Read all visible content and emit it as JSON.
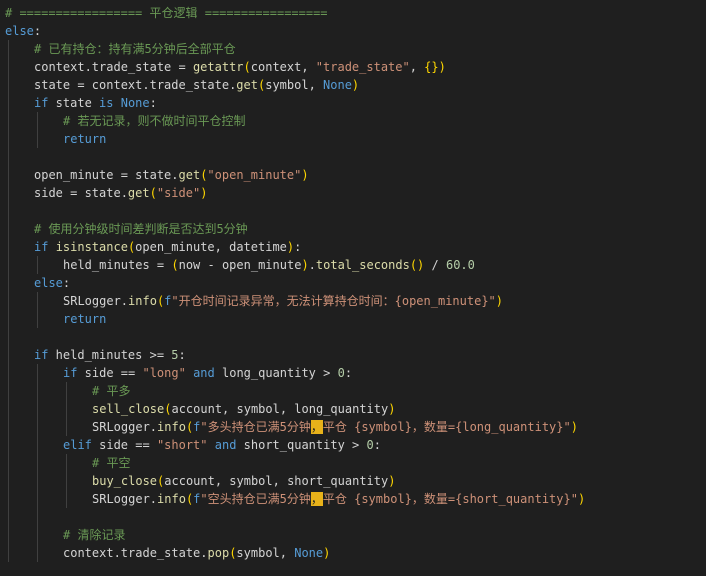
{
  "editor": {
    "language": "python",
    "colors": {
      "background": "#1f1f1f",
      "comment": "#6a9955",
      "keyword": "#569cd6",
      "function": "#dcdcaa",
      "string": "#ce9178",
      "number": "#b5cea8",
      "text": "#d4d4d4",
      "bracket": "#ffd700",
      "highlight": "#e8b21a"
    },
    "lines": [
      {
        "indent": 0,
        "tokens": [
          {
            "t": "# ================= 平仓逻辑 =================",
            "c": "comment"
          }
        ]
      },
      {
        "indent": 0,
        "tokens": [
          {
            "t": "else",
            "c": "keyword"
          },
          {
            "t": ":",
            "c": "plain"
          }
        ]
      },
      {
        "indent": 1,
        "tokens": [
          {
            "t": "# 已有持仓：持有满5分钟后全部平仓",
            "c": "comment"
          }
        ]
      },
      {
        "indent": 1,
        "tokens": [
          {
            "t": "context.trade_state = ",
            "c": "plain"
          },
          {
            "t": "getattr",
            "c": "func"
          },
          {
            "t": "(",
            "c": "paren"
          },
          {
            "t": "context, ",
            "c": "plain"
          },
          {
            "t": "\"trade_state\"",
            "c": "string"
          },
          {
            "t": ", ",
            "c": "plain"
          },
          {
            "t": "{}",
            "c": "paren"
          },
          {
            "t": ")",
            "c": "paren"
          }
        ]
      },
      {
        "indent": 1,
        "tokens": [
          {
            "t": "state = context.trade_state.",
            "c": "plain"
          },
          {
            "t": "get",
            "c": "func"
          },
          {
            "t": "(",
            "c": "paren"
          },
          {
            "t": "symbol, ",
            "c": "plain"
          },
          {
            "t": "None",
            "c": "keyword"
          },
          {
            "t": ")",
            "c": "paren"
          }
        ]
      },
      {
        "indent": 1,
        "tokens": [
          {
            "t": "if",
            "c": "keyword"
          },
          {
            "t": " state ",
            "c": "plain"
          },
          {
            "t": "is",
            "c": "keyword"
          },
          {
            "t": " ",
            "c": "plain"
          },
          {
            "t": "None",
            "c": "keyword"
          },
          {
            "t": ":",
            "c": "plain"
          }
        ]
      },
      {
        "indent": 2,
        "tokens": [
          {
            "t": "# 若无记录，则不做时间平仓控制",
            "c": "comment"
          }
        ]
      },
      {
        "indent": 2,
        "tokens": [
          {
            "t": "return",
            "c": "keyword"
          }
        ]
      },
      {
        "indent": 1,
        "tokens": []
      },
      {
        "indent": 1,
        "tokens": [
          {
            "t": "open_minute = state.",
            "c": "plain"
          },
          {
            "t": "get",
            "c": "func"
          },
          {
            "t": "(",
            "c": "paren"
          },
          {
            "t": "\"open_minute\"",
            "c": "string"
          },
          {
            "t": ")",
            "c": "paren"
          }
        ]
      },
      {
        "indent": 1,
        "tokens": [
          {
            "t": "side = state.",
            "c": "plain"
          },
          {
            "t": "get",
            "c": "func"
          },
          {
            "t": "(",
            "c": "paren"
          },
          {
            "t": "\"side\"",
            "c": "string"
          },
          {
            "t": ")",
            "c": "paren"
          }
        ]
      },
      {
        "indent": 1,
        "tokens": []
      },
      {
        "indent": 1,
        "tokens": [
          {
            "t": "# 使用分钟级时间差判断是否达到5分钟",
            "c": "comment"
          }
        ]
      },
      {
        "indent": 1,
        "tokens": [
          {
            "t": "if",
            "c": "keyword"
          },
          {
            "t": " ",
            "c": "plain"
          },
          {
            "t": "isinstance",
            "c": "func"
          },
          {
            "t": "(",
            "c": "paren"
          },
          {
            "t": "open_minute, datetime",
            "c": "plain"
          },
          {
            "t": ")",
            "c": "paren"
          },
          {
            "t": ":",
            "c": "plain"
          }
        ]
      },
      {
        "indent": 2,
        "tokens": [
          {
            "t": "held_minutes = ",
            "c": "plain"
          },
          {
            "t": "(",
            "c": "paren"
          },
          {
            "t": "now - open_minute",
            "c": "plain"
          },
          {
            "t": ")",
            "c": "paren"
          },
          {
            "t": ".",
            "c": "plain"
          },
          {
            "t": "total_seconds",
            "c": "func"
          },
          {
            "t": "()",
            "c": "paren"
          },
          {
            "t": " / ",
            "c": "plain"
          },
          {
            "t": "60.0",
            "c": "number"
          }
        ]
      },
      {
        "indent": 1,
        "tokens": [
          {
            "t": "else",
            "c": "keyword"
          },
          {
            "t": ":",
            "c": "plain"
          }
        ]
      },
      {
        "indent": 2,
        "tokens": [
          {
            "t": "SRLogger.",
            "c": "plain"
          },
          {
            "t": "info",
            "c": "func"
          },
          {
            "t": "(",
            "c": "paren"
          },
          {
            "t": "f",
            "c": "keyword"
          },
          {
            "t": "\"开仓时间记录异常，无法计算持仓时间：{open_minute}\"",
            "c": "string"
          },
          {
            "t": ")",
            "c": "paren"
          }
        ]
      },
      {
        "indent": 2,
        "tokens": [
          {
            "t": "return",
            "c": "keyword"
          }
        ]
      },
      {
        "indent": 1,
        "tokens": []
      },
      {
        "indent": 1,
        "tokens": [
          {
            "t": "if",
            "c": "keyword"
          },
          {
            "t": " held_minutes >= ",
            "c": "plain"
          },
          {
            "t": "5",
            "c": "number"
          },
          {
            "t": ":",
            "c": "plain"
          }
        ]
      },
      {
        "indent": 2,
        "tokens": [
          {
            "t": "if",
            "c": "keyword"
          },
          {
            "t": " side == ",
            "c": "plain"
          },
          {
            "t": "\"long\"",
            "c": "string"
          },
          {
            "t": " ",
            "c": "plain"
          },
          {
            "t": "and",
            "c": "keyword"
          },
          {
            "t": " long_quantity > ",
            "c": "plain"
          },
          {
            "t": "0",
            "c": "number"
          },
          {
            "t": ":",
            "c": "plain"
          }
        ]
      },
      {
        "indent": 3,
        "tokens": [
          {
            "t": "# 平多",
            "c": "comment"
          }
        ]
      },
      {
        "indent": 3,
        "tokens": [
          {
            "t": "sell_close",
            "c": "func"
          },
          {
            "t": "(",
            "c": "paren"
          },
          {
            "t": "account, symbol, long_quantity",
            "c": "plain"
          },
          {
            "t": ")",
            "c": "paren"
          }
        ]
      },
      {
        "indent": 3,
        "tokens": [
          {
            "t": "SRLogger.",
            "c": "plain"
          },
          {
            "t": "info",
            "c": "func"
          },
          {
            "t": "(",
            "c": "paren"
          },
          {
            "t": "f",
            "c": "keyword"
          },
          {
            "t": "\"多头持仓已满5分钟",
            "c": "string"
          },
          {
            "t": "，",
            "c": "cursor"
          },
          {
            "t": "平仓 {symbol}，数量={long_quantity}\"",
            "c": "string"
          },
          {
            "t": ")",
            "c": "paren"
          }
        ]
      },
      {
        "indent": 2,
        "tokens": [
          {
            "t": "elif",
            "c": "keyword"
          },
          {
            "t": " side == ",
            "c": "plain"
          },
          {
            "t": "\"short\"",
            "c": "string"
          },
          {
            "t": " ",
            "c": "plain"
          },
          {
            "t": "and",
            "c": "keyword"
          },
          {
            "t": " short_quantity > ",
            "c": "plain"
          },
          {
            "t": "0",
            "c": "number"
          },
          {
            "t": ":",
            "c": "plain"
          }
        ]
      },
      {
        "indent": 3,
        "tokens": [
          {
            "t": "# 平空",
            "c": "comment"
          }
        ]
      },
      {
        "indent": 3,
        "tokens": [
          {
            "t": "buy_close",
            "c": "func"
          },
          {
            "t": "(",
            "c": "paren"
          },
          {
            "t": "account, symbol, short_quantity",
            "c": "plain"
          },
          {
            "t": ")",
            "c": "paren"
          }
        ]
      },
      {
        "indent": 3,
        "tokens": [
          {
            "t": "SRLogger.",
            "c": "plain"
          },
          {
            "t": "info",
            "c": "func"
          },
          {
            "t": "(",
            "c": "paren"
          },
          {
            "t": "f",
            "c": "keyword"
          },
          {
            "t": "\"空头持仓已满5分钟",
            "c": "string"
          },
          {
            "t": "，",
            "c": "cursor"
          },
          {
            "t": "平仓 {symbol}，数量={short_quantity}\"",
            "c": "string"
          },
          {
            "t": ")",
            "c": "paren"
          }
        ]
      },
      {
        "indent": 2,
        "tokens": []
      },
      {
        "indent": 2,
        "tokens": [
          {
            "t": "# 清除记录",
            "c": "comment"
          }
        ]
      },
      {
        "indent": 2,
        "tokens": [
          {
            "t": "context.trade_state.",
            "c": "plain"
          },
          {
            "t": "pop",
            "c": "func"
          },
          {
            "t": "(",
            "c": "paren"
          },
          {
            "t": "symbol, ",
            "c": "plain"
          },
          {
            "t": "None",
            "c": "keyword"
          },
          {
            "t": ")",
            "c": "paren"
          }
        ]
      }
    ]
  }
}
